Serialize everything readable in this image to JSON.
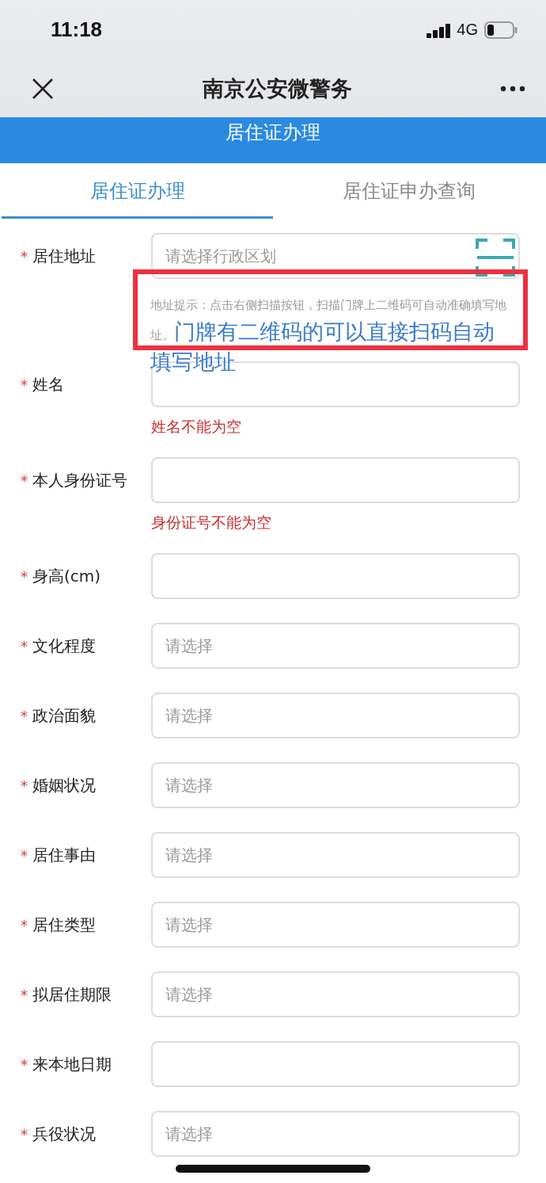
{
  "status_bar": {
    "time": "11:18",
    "network": "4G"
  },
  "nav": {
    "title": "南京公安微警务"
  },
  "header": {
    "title": "居住证办理"
  },
  "tabs": [
    {
      "label": "居住证办理",
      "selected": true
    },
    {
      "label": "居住证申办查询",
      "selected": false
    }
  ],
  "form": {
    "fields": [
      {
        "label": "居住地址",
        "mark": "*",
        "kind": "scan",
        "placeholder": "请选择行政区划",
        "hint": "地址提示：点击右侧扫描按钮，扫描门牌上二维码可自动准确填写地址。",
        "annotation": "门牌有二维码的可以直接扫码自动填写地址"
      },
      {
        "label": "姓名",
        "mark": "*",
        "kind": "text",
        "error": "姓名不能为空"
      },
      {
        "label": "本人身份证号",
        "mark": "*",
        "kind": "text",
        "error": "身份证号不能为空"
      },
      {
        "label": "身高(cm)",
        "mark": "*",
        "kind": "text"
      },
      {
        "label": "文化程度",
        "mark": "*",
        "kind": "select",
        "placeholder": "请选择"
      },
      {
        "label": "政治面貌",
        "mark": "*",
        "kind": "select",
        "placeholder": "请选择"
      },
      {
        "label": "婚姻状况",
        "mark": "*",
        "kind": "select",
        "placeholder": "请选择"
      },
      {
        "label": "居住事由",
        "mark": "*",
        "kind": "select",
        "placeholder": "请选择"
      },
      {
        "label": "居住类型",
        "mark": "*",
        "kind": "select",
        "placeholder": "请选择"
      },
      {
        "label": "拟居住期限",
        "mark": "*",
        "kind": "select",
        "placeholder": "请选择"
      },
      {
        "label": "来本地日期",
        "mark": "*",
        "kind": "text"
      },
      {
        "label": "兵役状况",
        "mark": "*",
        "kind": "select",
        "placeholder": "请选择"
      }
    ]
  }
}
